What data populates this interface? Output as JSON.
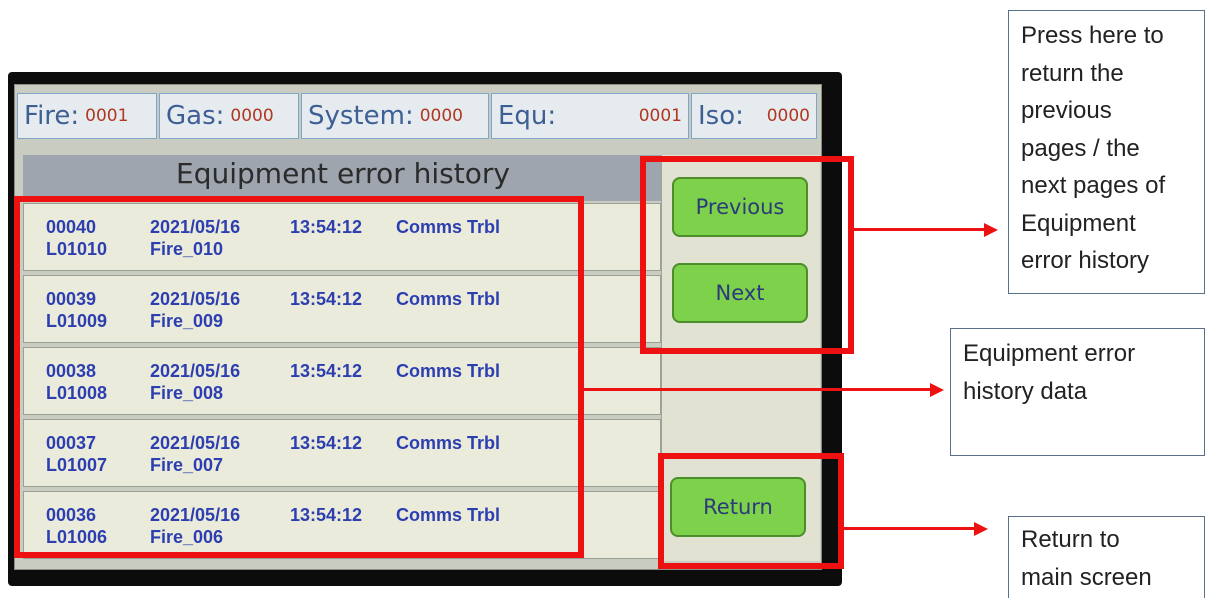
{
  "status_bar": [
    {
      "label": "Fire:",
      "value": "0001"
    },
    {
      "label": "Gas:",
      "value": "0000"
    },
    {
      "label": "System:",
      "value": "0000"
    },
    {
      "label": "Equ:",
      "value": "0001"
    },
    {
      "label": "Iso:",
      "value": "0000"
    }
  ],
  "screen_title": "Equipment error history",
  "entries": [
    {
      "index": "00040",
      "date": "2021/05/16",
      "time": "13:54:12",
      "event": "Comms Trbl",
      "loop": "L01010",
      "device": "Fire_010"
    },
    {
      "index": "00039",
      "date": "2021/05/16",
      "time": "13:54:12",
      "event": "Comms Trbl",
      "loop": "L01009",
      "device": "Fire_009"
    },
    {
      "index": "00038",
      "date": "2021/05/16",
      "time": "13:54:12",
      "event": "Comms Trbl",
      "loop": "L01008",
      "device": "Fire_008"
    },
    {
      "index": "00037",
      "date": "2021/05/16",
      "time": "13:54:12",
      "event": "Comms Trbl",
      "loop": "L01007",
      "device": "Fire_007"
    },
    {
      "index": "00036",
      "date": "2021/05/16",
      "time": "13:54:12",
      "event": "Comms Trbl",
      "loop": "L01006",
      "device": "Fire_006"
    }
  ],
  "buttons": {
    "previous": "Previous",
    "next": "Next",
    "return": "Return"
  },
  "callouts": {
    "pages": [
      "Press here to",
      "return the",
      "previous",
      "pages / the",
      "next pages of",
      "Equipment",
      "error history"
    ],
    "data": [
      "Equipment error",
      "history data"
    ],
    "return": [
      "Return to",
      "main screen"
    ]
  },
  "colors": {
    "highlight": "#ee1111",
    "button": "#7ed14a",
    "entry_text": "#2d3fb0",
    "status_label": "#3d5f94",
    "status_value": "#b03820"
  }
}
